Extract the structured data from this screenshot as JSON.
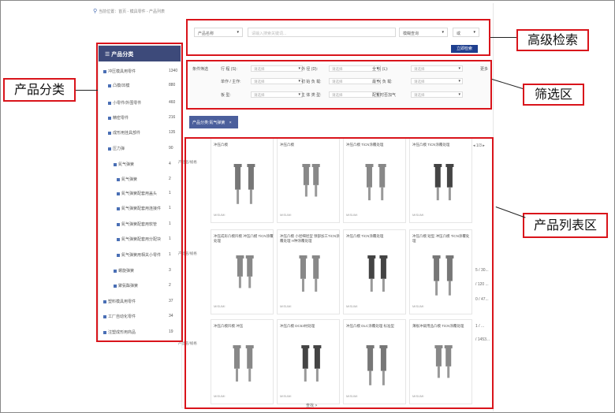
{
  "breadcrumb": "当前位置：首页 - 模具零件 - 产品列表",
  "sidebar": {
    "title": "产品分类",
    "items": [
      {
        "label": "冲压模具用零件",
        "count": "1340"
      },
      {
        "label": "凸模/凹模",
        "count": "880"
      },
      {
        "label": "小零件/外围零件",
        "count": "460"
      },
      {
        "label": "精密零件",
        "count": "216"
      },
      {
        "label": "成形用挂具部件",
        "count": "135"
      },
      {
        "label": "压力弹",
        "count": "90"
      },
      {
        "label": "氮气弹簧",
        "count": "4"
      },
      {
        "label": "氮气弹簧",
        "count": "2"
      },
      {
        "label": "氮气弹簧配套用盖头",
        "count": "1"
      },
      {
        "label": "氮气弹簧配套用连接件",
        "count": "1"
      },
      {
        "label": "氮气弹簧配套用软管",
        "count": "1"
      },
      {
        "label": "氮气弹簧配套用分配块",
        "count": "1"
      },
      {
        "label": "氮气弹簧用相关小零件",
        "count": "1"
      },
      {
        "label": "螺旋弹簧",
        "count": "3"
      },
      {
        "label": "聚氨酯弹簧",
        "count": "2"
      },
      {
        "label": "塑料模具用零件",
        "count": "37"
      },
      {
        "label": "工厂自动化零件",
        "count": "34"
      },
      {
        "label": "注塑成形用商品",
        "count": "19"
      }
    ]
  },
  "search": {
    "field_select": "产品名称",
    "placeholder": "请输入搜索关键词...",
    "mode_select": "模糊查询",
    "logic_select": "或",
    "button": "立即检索"
  },
  "filter": {
    "title": "条件筛选",
    "more": "更多",
    "rows": [
      [
        {
          "label": "行 程 (S):",
          "value": "请选择"
        },
        {
          "label": "外 径 (D):",
          "value": "请选择"
        },
        {
          "label": "全 长 (L):",
          "value": "请选择"
        }
      ],
      [
        {
          "label": "单作 / 主作:",
          "value": "请选择"
        },
        {
          "label": "初 始 负 载:",
          "value": "请选择"
        },
        {
          "label": "最 大 负 载:",
          "value": "请选择"
        }
      ],
      [
        {
          "label": "板 型:",
          "value": "请选择"
        },
        {
          "label": "主 体 类 型:",
          "value": "请选择"
        },
        {
          "label": "配置时否加气",
          "value": "请选择"
        }
      ]
    ]
  },
  "active_chip": {
    "label": "产品分类:氮气弹簧",
    "close": "×"
  },
  "grid": {
    "nav": "◂ 1/3 ▸",
    "row_labels": [
      "产品名/规格",
      "产品名/规格",
      "产品名/规格"
    ],
    "side_values": [
      "5 / 30...",
      "/ 120 ...",
      "0 / 47...",
      "1 / ...",
      "/ 1453..."
    ],
    "rows": [
      [
        "冲压凸模",
        "冲压凸模",
        "冲压凸模 TiCN涂覆处理",
        "冲压凸模 TiCN涂覆处理"
      ],
      [
        "冲压成形凸模凹模 冲压凸模 TiCN涂覆处理",
        "冲压凸模 小径细径型 颈部加工TiCN涂覆处理 H种涂覆处理",
        "冲压凸模 TiCN涂覆处理",
        "冲压凸模 短型 冲压凸模 TiCN涂覆处理"
      ],
      [
        "冲压凸模凹模 冲压",
        "冲压凸模 DC53材处理",
        "冲压凸模 DLC涂覆处理 标准型",
        "薄板冲裁用品凸模 TiCN涂覆处理"
      ]
    ],
    "brand": "MISUMI",
    "footer": "查找 >"
  },
  "annotations": {
    "search": "高级检索",
    "filter": "筛选区",
    "category": "产品分类",
    "list": "产品列表区"
  },
  "colors": {
    "accent": "#d9141b",
    "nav": "#3d4a7a",
    "button": "#1e3f8f"
  }
}
